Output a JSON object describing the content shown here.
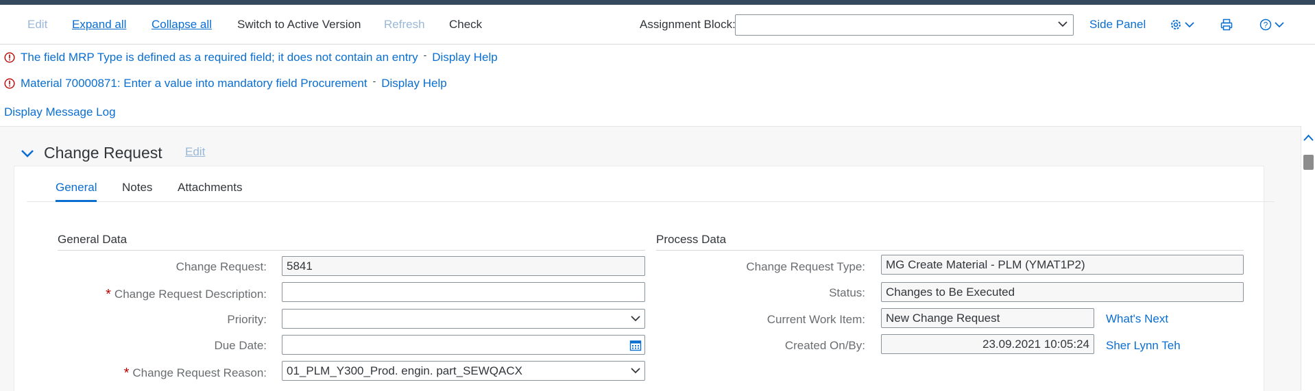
{
  "toolbar": {
    "edit": "Edit",
    "expand_all": "Expand all",
    "collapse_all": "Collapse all",
    "switch_active": "Switch to Active Version",
    "refresh": "Refresh",
    "check": "Check",
    "assignment_block_label": "Assignment Block:",
    "assignment_block_value": "",
    "side_panel": "Side Panel",
    "icons": [
      "gear-icon",
      "printer-icon",
      "help-icon"
    ]
  },
  "messages": [
    {
      "text": "The field MRP Type is defined as a required field; it does not contain an entry",
      "separator": "-",
      "link": "Display Help"
    },
    {
      "text": "Material 70000871: Enter a value into mandatory field Procurement",
      "separator": "-",
      "link": "Display Help"
    }
  ],
  "message_log": "Display Message Log",
  "section": {
    "title": "Change Request",
    "edit": "Edit"
  },
  "tabs": [
    "General",
    "Notes",
    "Attachments"
  ],
  "general_data": {
    "title": "General Data",
    "change_request_label": "Change Request:",
    "change_request_value": "5841",
    "description_label": "Change Request Description:",
    "description_value": "",
    "priority_label": "Priority:",
    "priority_value": "",
    "due_date_label": "Due Date:",
    "due_date_value": "",
    "reason_label": "Change Request Reason:",
    "reason_value": "01_PLM_Y300_Prod. engin. part_SEWQACX"
  },
  "process_data": {
    "title": "Process Data",
    "type_label": "Change Request Type:",
    "type_value": "MG Create Material - PLM (YMAT1P2)",
    "status_label": "Status:",
    "status_value": "Changes to Be Executed",
    "work_item_label": "Current Work Item:",
    "work_item_value": "New Change Request",
    "whats_next": "What's Next",
    "created_label": "Created On/By:",
    "created_value": "23.09.2021 10:05:24",
    "created_by": "Sher Lynn Teh"
  },
  "colors": {
    "accent": "#0a6ed1",
    "error": "#bb0000",
    "shell": "#354a5f"
  }
}
